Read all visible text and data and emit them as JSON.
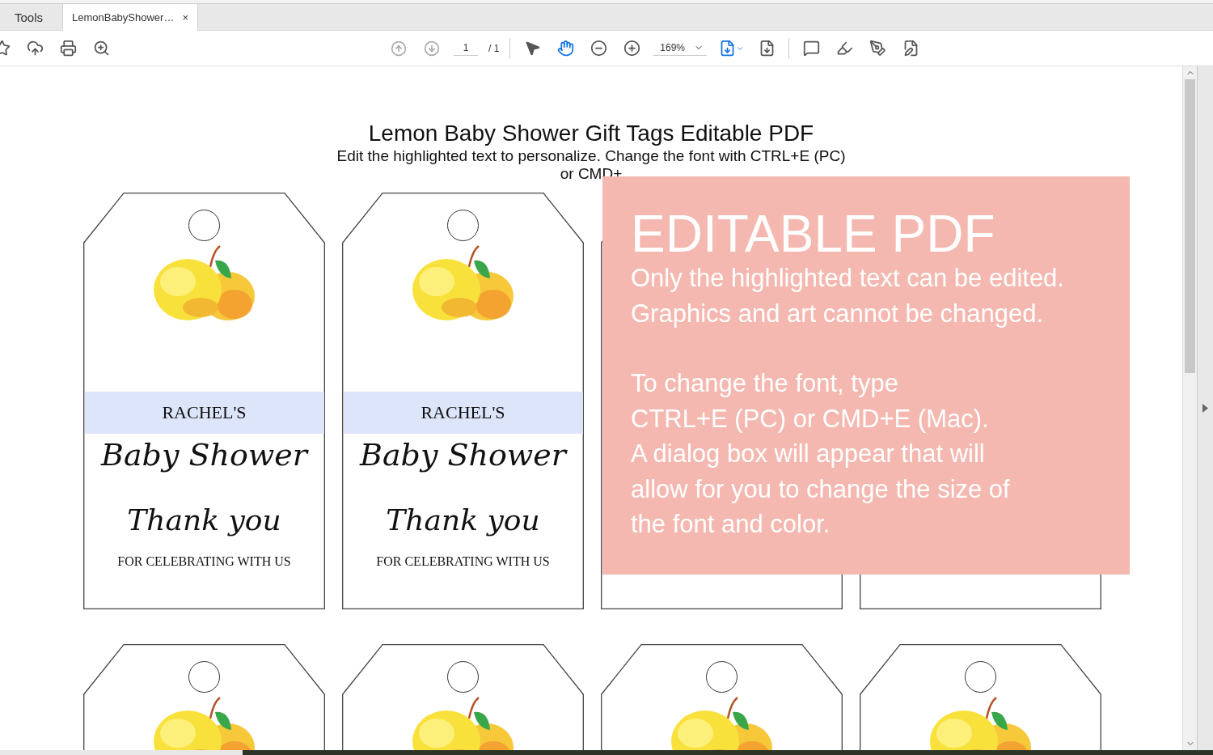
{
  "tabs": [
    {
      "label": "Tools",
      "selected": false
    },
    {
      "label": "LemonBabyShower…",
      "selected": true,
      "close": "×"
    }
  ],
  "toolbar": {
    "left_tools": [
      {
        "kind": "star"
      },
      {
        "kind": "upload"
      },
      {
        "kind": "print"
      },
      {
        "kind": "search"
      }
    ],
    "page_input": "1",
    "page_total": "/ 1",
    "zoom": "169%",
    "tools": [
      {
        "kind": "pointer",
        "selected": false
      },
      {
        "kind": "hand",
        "selected": true
      }
    ],
    "right_tools": [
      {
        "kind": "comment"
      },
      {
        "kind": "highlight"
      },
      {
        "kind": "sign"
      },
      {
        "kind": "edit"
      }
    ]
  },
  "document": {
    "title": "Lemon Baby Shower Gift Tags Editable PDF",
    "subtitle_lines": [
      "Edit the highlighted text to personalize. Change the font with CTRL+E (PC)",
      "or CMD+"
    ],
    "tag_rows": [
      [
        {
          "kind": "full",
          "name": "RACHEL'S",
          "heading": "Baby Shower",
          "thanks": "Thank you",
          "footer": "FOR CELEBRATING WITH US"
        },
        {
          "kind": "full",
          "name": "RACHEL'S",
          "heading": "Baby Shower",
          "thanks": "Thank you",
          "footer": "FOR CELEBRATING WITH US"
        },
        {
          "kind": "covered"
        },
        {
          "kind": "covered"
        }
      ],
      [
        {
          "kind": "cut"
        },
        {
          "kind": "cut"
        },
        {
          "kind": "cut"
        },
        {
          "kind": "cut"
        }
      ]
    ],
    "notice": {
      "title": "EDITABLE PDF",
      "paragraphs": [
        [
          "Only the highlighted text can be edited.",
          "Graphics and art cannot be changed."
        ],
        [
          "To change the font, type",
          "CTRL+E (PC) or CMD+E (Mac).",
          "A dialog box will appear that will",
          "allow for you to change the size of",
          "the font and color."
        ]
      ]
    }
  }
}
